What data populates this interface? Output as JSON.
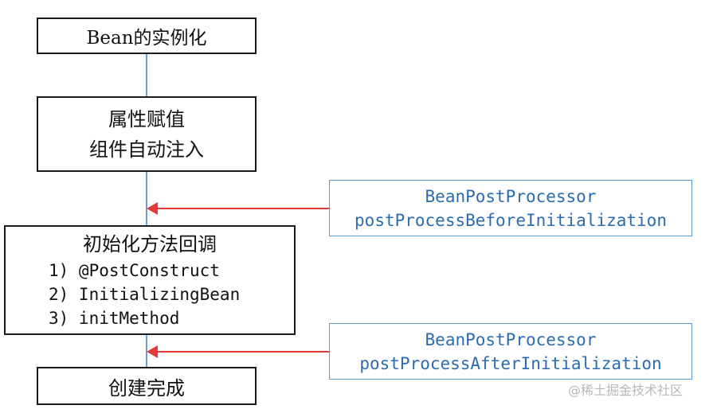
{
  "boxes": {
    "instantiation": "Bean的实例化",
    "populate_line1": "属性赋值",
    "populate_line2": "组件自动注入",
    "init_title": "初始化方法回调",
    "init_steps": [
      "1) @PostConstruct",
      "2) InitializingBean",
      "3) initMethod"
    ],
    "complete": "创建完成"
  },
  "processors": {
    "before": {
      "line1": "BeanPostProcessor",
      "line2": "postProcessBeforeInitialization"
    },
    "after": {
      "line1": "BeanPostProcessor",
      "line2": "postProcessAfterInitialization"
    }
  },
  "watermark": "@稀土掘金技术社区",
  "colors": {
    "flow_line": "#6a9fd4",
    "arrow": "#e53935",
    "processor_border": "#5b9bd5",
    "processor_text": "#2b6cb0"
  }
}
